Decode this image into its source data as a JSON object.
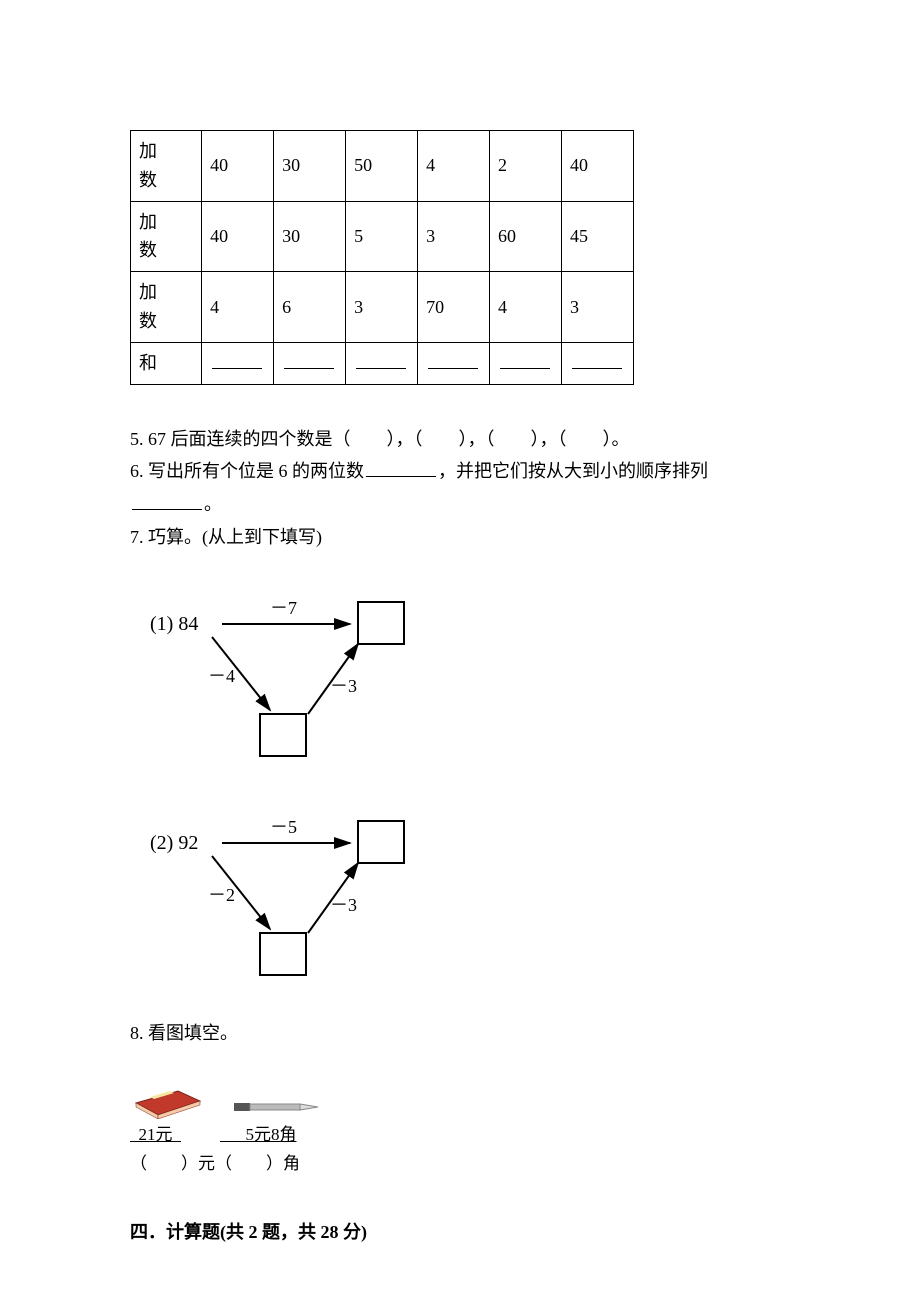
{
  "table": {
    "row_labels": [
      "加数",
      "加数",
      "加数",
      "和"
    ],
    "rows": [
      [
        "40",
        "30",
        "50",
        "4",
        "2",
        "40"
      ],
      [
        "40",
        "30",
        "5",
        "3",
        "60",
        "45"
      ],
      [
        "4",
        "6",
        "3",
        "70",
        "4",
        "3"
      ]
    ]
  },
  "q5": {
    "prefix": "5. 67 后面连续的四个数是（　　），（　　），（　　），（　　）。"
  },
  "q6": {
    "a": "6. 写出所有个位是 6 的两位数",
    "b": "，并把它们按从大到小的顺序排列",
    "c": "。"
  },
  "q7": {
    "title": "7. 巧算。(从上到下填写)",
    "d1": {
      "label": "(1) 84",
      "top": "－7",
      "left": "－4",
      "right": "－3"
    },
    "d2": {
      "label": "(2) 92",
      "top": "－5",
      "left": "－2",
      "right": "－3"
    }
  },
  "q8": {
    "title": "8. 看图填空。",
    "price1": "21元",
    "price2": "5元8角",
    "fill": "（　　）元（　　）角"
  },
  "section4": "四．计算题(共 2 题，共 28 分)"
}
